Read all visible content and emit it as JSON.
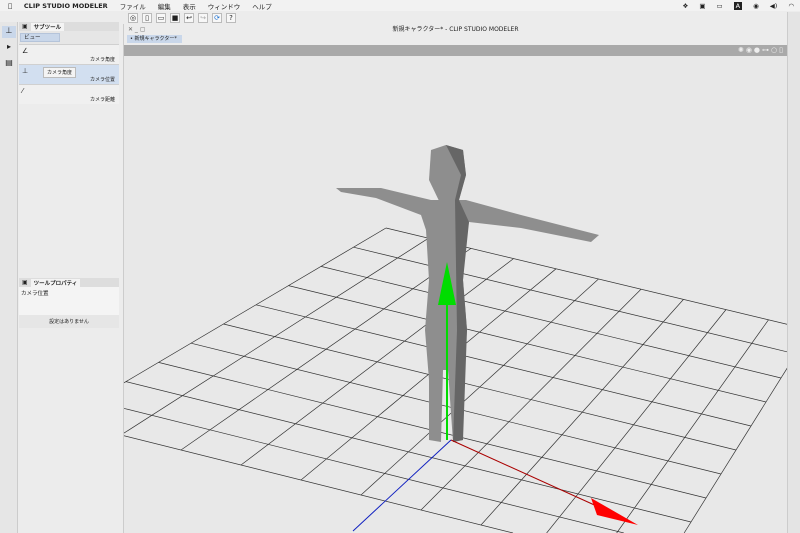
{
  "menubar": {
    "app": "CLIP STUDIO MODELER",
    "items": [
      "ファイル",
      "編集",
      "表示",
      "ウィンドウ",
      "ヘルプ"
    ]
  },
  "window": {
    "title": "新規キャラクター* - CLIP STUDIO MODELER",
    "doc_tab": "新規キャラクター*"
  },
  "subtool": {
    "tab": "サブツール",
    "view_button": "ビュー",
    "items": [
      {
        "label": "カメラ角度"
      },
      {
        "label": "カメラ位置"
      },
      {
        "label": "カメラ距離"
      }
    ],
    "tooltip": "カメラ角度"
  },
  "tool_property": {
    "tab": "ツールプロパティ",
    "current": "カメラ位置",
    "note": "設定はありません"
  },
  "colors": {
    "x_axis": "#ff0000",
    "y_axis": "#00dd00",
    "z_axis": "#1020c0",
    "selection": "#c9d7ea"
  }
}
